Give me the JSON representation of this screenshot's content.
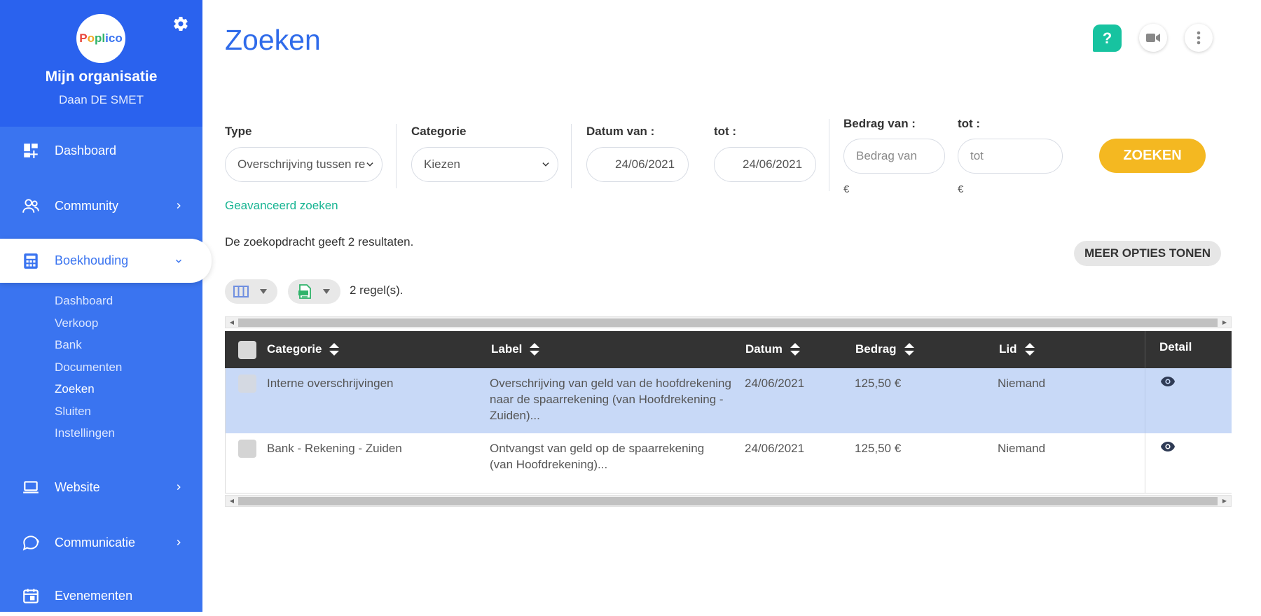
{
  "sidebar": {
    "logo": {
      "part1": "P",
      "part2": "o",
      "part3": "pl",
      "part4": "ico"
    },
    "org_name": "Mijn organisatie",
    "user_name": "Daan DE SMET",
    "nav": {
      "dashboard": "Dashboard",
      "community": "Community",
      "boekhouding": "Boekhouding",
      "website": "Website",
      "communicatie": "Communicatie",
      "evenementen": "Evenementen"
    },
    "subnav": [
      "Dashboard",
      "Verkoop",
      "Bank",
      "Documenten",
      "Zoeken",
      "Sluiten",
      "Instellingen"
    ],
    "colors": {
      "background": "#3a74f0",
      "header": "#2a62ee"
    }
  },
  "header": {
    "title": "Zoeken",
    "help_label": "?",
    "icons": [
      "help-icon",
      "video-camera-icon",
      "more-vertical-icon"
    ]
  },
  "filters": {
    "type_label": "Type",
    "type_value": "Overschrijving tussen re",
    "categorie_label": "Categorie",
    "categorie_value": "Kiezen",
    "datum_van_label": "Datum van :",
    "datum_van_value": "24/06/2021",
    "tot_label": "tot :",
    "tot_value": "24/06/2021",
    "bedrag_van_label": "Bedrag van :",
    "bedrag_van_placeholder": "Bedrag van",
    "bedrag_tot_label": "tot :",
    "bedrag_tot_placeholder": "tot",
    "currency_symbol": "€",
    "search_button": "ZOEKEN",
    "advanced_link": "Geavanceerd zoeken"
  },
  "results": {
    "summary": "De zoekopdracht geeft 2 resultaten.",
    "more_options": "MEER OPTIES TONEN",
    "row_count": "2 regel(s)."
  },
  "table": {
    "columns": {
      "categorie": "Categorie",
      "label": "Label",
      "datum": "Datum",
      "bedrag": "Bedrag",
      "lid": "Lid",
      "detail": "Detail"
    },
    "rows": [
      {
        "categorie": "Interne overschrijvingen",
        "label": [
          "Overschrijving van geld van de hoofdrekening",
          "naar de spaarrekening (van Hoofdrekening -",
          "Zuiden)..."
        ],
        "datum": "24/06/2021",
        "bedrag": "125,50 €",
        "lid": "Niemand"
      },
      {
        "categorie": "Bank - Rekening - Zuiden",
        "label": [
          "Ontvangst van geld op de spaarrekening",
          "(van Hoofdrekening)..."
        ],
        "datum": "24/06/2021",
        "bedrag": "125,50 €",
        "lid": "Niemand"
      }
    ],
    "colors": {
      "header_bg": "#333333",
      "selected_row_bg": "#c8d9f7"
    }
  },
  "colors": {
    "accent": "#2f6bea",
    "search_button": "#f4b821",
    "link": "#17b492",
    "help": "#17c3a0"
  }
}
